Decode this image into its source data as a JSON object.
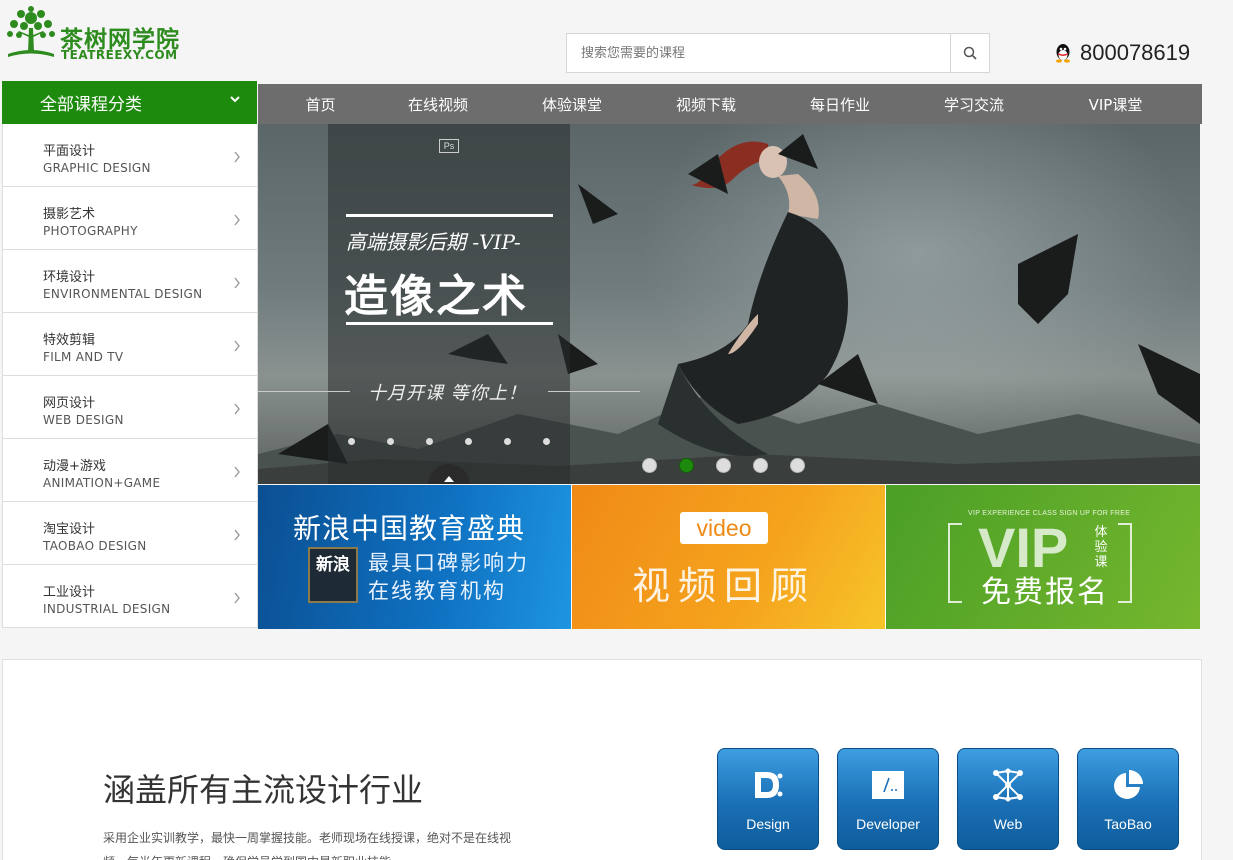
{
  "brand": {
    "name_cn": "茶树网学院",
    "name_en": "TEATREEXY.COM"
  },
  "search": {
    "placeholder": "搜索您需要的课程"
  },
  "contact": {
    "qq_number": "800078619"
  },
  "category": {
    "header": "全部课程分类",
    "items": [
      {
        "zh": "平面设计",
        "en": "GRAPHIC DESIGN"
      },
      {
        "zh": "摄影艺术",
        "en": "PHOTOGRAPHY"
      },
      {
        "zh": "环境设计",
        "en": "ENVIRONMENTAL DESIGN"
      },
      {
        "zh": "特效剪辑",
        "en": "FILM AND TV"
      },
      {
        "zh": "网页设计",
        "en": "WEB DESIGN"
      },
      {
        "zh": "动漫+游戏",
        "en": "ANIMATION+GAME"
      },
      {
        "zh": "淘宝设计",
        "en": "TAOBAO DESIGN"
      },
      {
        "zh": "工业设计",
        "en": "INDUSTRIAL DESIGN"
      }
    ]
  },
  "nav": [
    "首页",
    "在线视频",
    "体验课堂",
    "视频下载",
    "每日作业",
    "学习交流",
    "VIP课堂"
  ],
  "banner": {
    "badge": "Ps",
    "title_small": "高端摄影后期 -VIP-",
    "title_big": "造像之术",
    "subtitle": "十月开课 等你上！",
    "active_slide": 2,
    "slide_count": 5
  },
  "tiles": {
    "t1": {
      "title": "新浪中国教育盛典",
      "line1": "最具口碑影响力",
      "line2": "在线教育机构",
      "logo": "新浪"
    },
    "t2": {
      "pill": "video",
      "title": "视频回顾"
    },
    "t3": {
      "tiny": "VIP EXPERIENCE CLASS SIGN UP FOR FREE",
      "big": "VIP",
      "side": "体验课",
      "free": "免费报名"
    }
  },
  "lower": {
    "heading": "涵盖所有主流设计行业",
    "desc": "采用企业实训教学，最快一周掌握技能。老师现场在线授课，绝对不是在线视频，每半年更新课程，确保学员学到国内最新职业技能。",
    "cards": [
      {
        "label": "Design",
        "icon": "design-icon"
      },
      {
        "label": "Developer",
        "icon": "code-icon"
      },
      {
        "label": "Web",
        "icon": "network-icon"
      },
      {
        "label": "TaoBao",
        "icon": "pie-chart-icon"
      }
    ]
  },
  "colors": {
    "brand_green": "#1e8a0d",
    "nav_gray": "#6d6d6d",
    "card_blue": "#1a6fb5"
  }
}
